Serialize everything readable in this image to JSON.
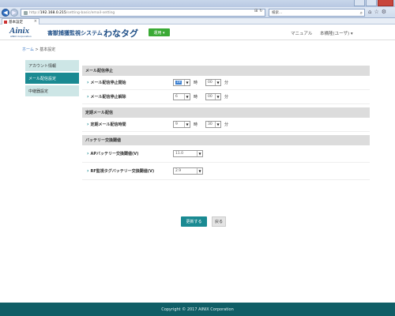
{
  "browser": {
    "url_proto": "http://",
    "url_host": "192.168.0.215",
    "url_path": "/setting-basic/email-setting",
    "search_placeholder": "検索...",
    "tab_title": "基本設定",
    "tab_close": "×"
  },
  "header": {
    "logo": "Ainix",
    "logo_sub": "AINIX Corporation",
    "system_name": "害獣捕獲監視システム",
    "brand": "わなタグ",
    "operate_button": "運用 ▾",
    "manual_link": "マニュアル",
    "user_menu": "本橋隆(ユーザ) ▾"
  },
  "breadcrumb": {
    "home": "ホーム",
    "sep": " > ",
    "current": "基本設定"
  },
  "sidebar": {
    "items": [
      {
        "label": "アカウント情報"
      },
      {
        "label": "メール配信設定"
      },
      {
        "label": "中継器設定"
      }
    ]
  },
  "sections": {
    "mail_stop": {
      "title": "メール配信停止",
      "start_label": "メール配信停止開始",
      "start_hour": "18",
      "start_min": "00",
      "end_label": "メール配信停止解除",
      "end_hour": "6",
      "end_min": "00"
    },
    "periodic": {
      "title": "定期メール配信",
      "time_label": "定期メール配信時間",
      "hour": "9",
      "min": "30"
    },
    "battery": {
      "title": "バッテリー交換閾値",
      "ap_label": "APバッテリー交換閾値(V)",
      "ap_value": "11.0",
      "rf_label": "RF監視タグバッテリー交換閾値(V)",
      "rf_value": "2.9"
    }
  },
  "units": {
    "hour": "時",
    "min": "分"
  },
  "actions": {
    "save": "更新する",
    "back": "戻る"
  },
  "footer": {
    "copyright": "Copyright © 2017 AINIX Corporation"
  },
  "colors": {
    "primary": "#1a8a92",
    "footer": "#105e66",
    "operate": "#3aaa35",
    "sidebar_inactive": "#cde6e6"
  }
}
